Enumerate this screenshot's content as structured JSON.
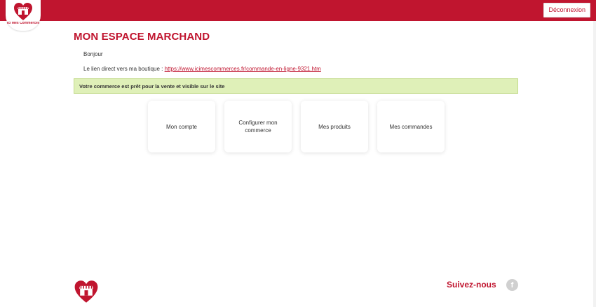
{
  "header": {
    "logo_text": "Ici Mes Commerces",
    "logout_label": "Déconnexion"
  },
  "main": {
    "title": "MON ESPACE MARCHAND",
    "greeting": "Bonjour",
    "shop_link_label": "Le lien direct vers ma boutique : ",
    "shop_link_url": "https://www.icimescommerces.fr/commande-en-ligne-9321.htm",
    "status_message": "Votre commerce est prêt pour la vente et visible sur le site",
    "tiles": [
      {
        "label": "Mon compte"
      },
      {
        "label": "Configurer mon commerce"
      },
      {
        "label": "Mes produits"
      },
      {
        "label": "Mes commandes"
      }
    ]
  },
  "footer": {
    "follow_label": "Suivez-nous",
    "social_icon": "facebook-icon",
    "fb_glyph": "f"
  },
  "colors": {
    "brand": "#c0152f",
    "success_bg": "#dff0b8"
  }
}
